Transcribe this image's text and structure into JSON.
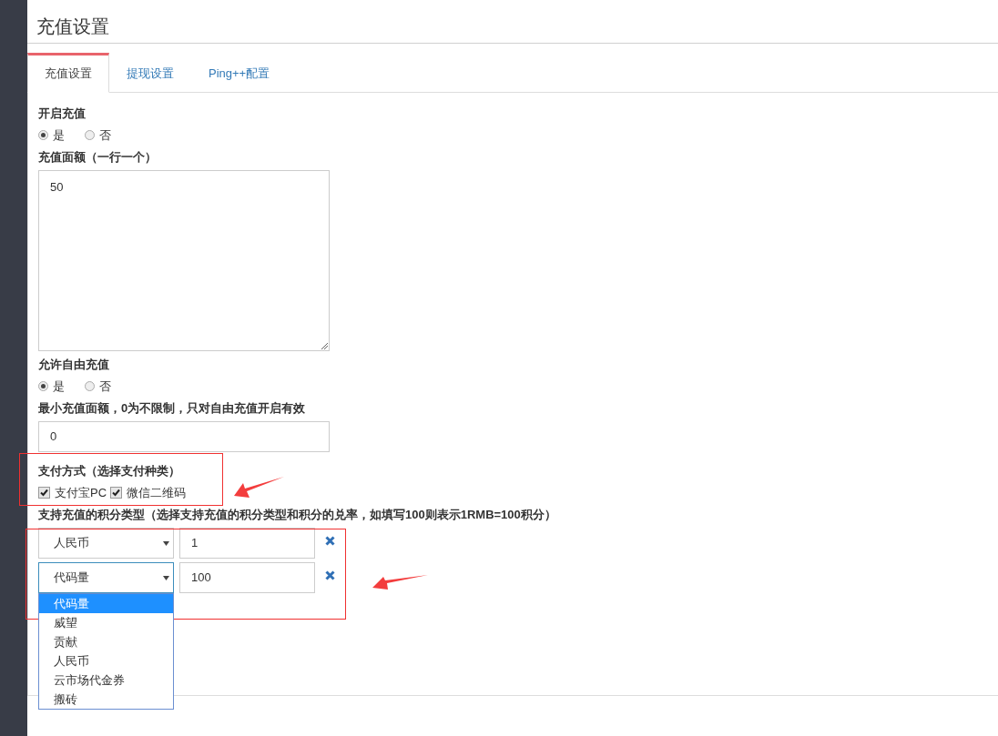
{
  "page_title": "充值设置",
  "tabs": [
    {
      "label": "充值设置",
      "selected": true
    },
    {
      "label": "提现设置",
      "selected": false
    },
    {
      "label": "Ping++配置",
      "selected": false
    }
  ],
  "enable_recharge": {
    "label": "开启充值",
    "options": [
      {
        "label": "是",
        "selected": true
      },
      {
        "label": "否",
        "selected": false
      }
    ]
  },
  "amounts": {
    "label": "充值面额（一行一个）",
    "value": "50"
  },
  "free_recharge": {
    "label": "允许自由充值",
    "options": [
      {
        "label": "是",
        "selected": true
      },
      {
        "label": "否",
        "selected": false
      }
    ]
  },
  "min_amount": {
    "label": "最小充值面额，0为不限制，只对自由充值开启有效",
    "value": "0"
  },
  "payment": {
    "label": "支付方式（选择支付种类）",
    "methods": [
      {
        "label": "支付宝PC",
        "checked": true
      },
      {
        "label": "微信二维码",
        "checked": true
      }
    ]
  },
  "points": {
    "label": "支持充值的积分类型（选择支持充值的积分类型和积分的兑率，如填写100则表示1RMB=100积分）",
    "rows": [
      {
        "type": "人民币",
        "rate": "1",
        "open": false
      },
      {
        "type": "代码量",
        "rate": "100",
        "open": true
      }
    ],
    "options": [
      {
        "label": "代码量",
        "selected": true
      },
      {
        "label": "威望",
        "selected": false
      },
      {
        "label": "贡献",
        "selected": false
      },
      {
        "label": "人民币",
        "selected": false
      },
      {
        "label": "云市场代金券",
        "selected": false
      },
      {
        "label": "搬砖",
        "selected": false
      }
    ]
  }
}
